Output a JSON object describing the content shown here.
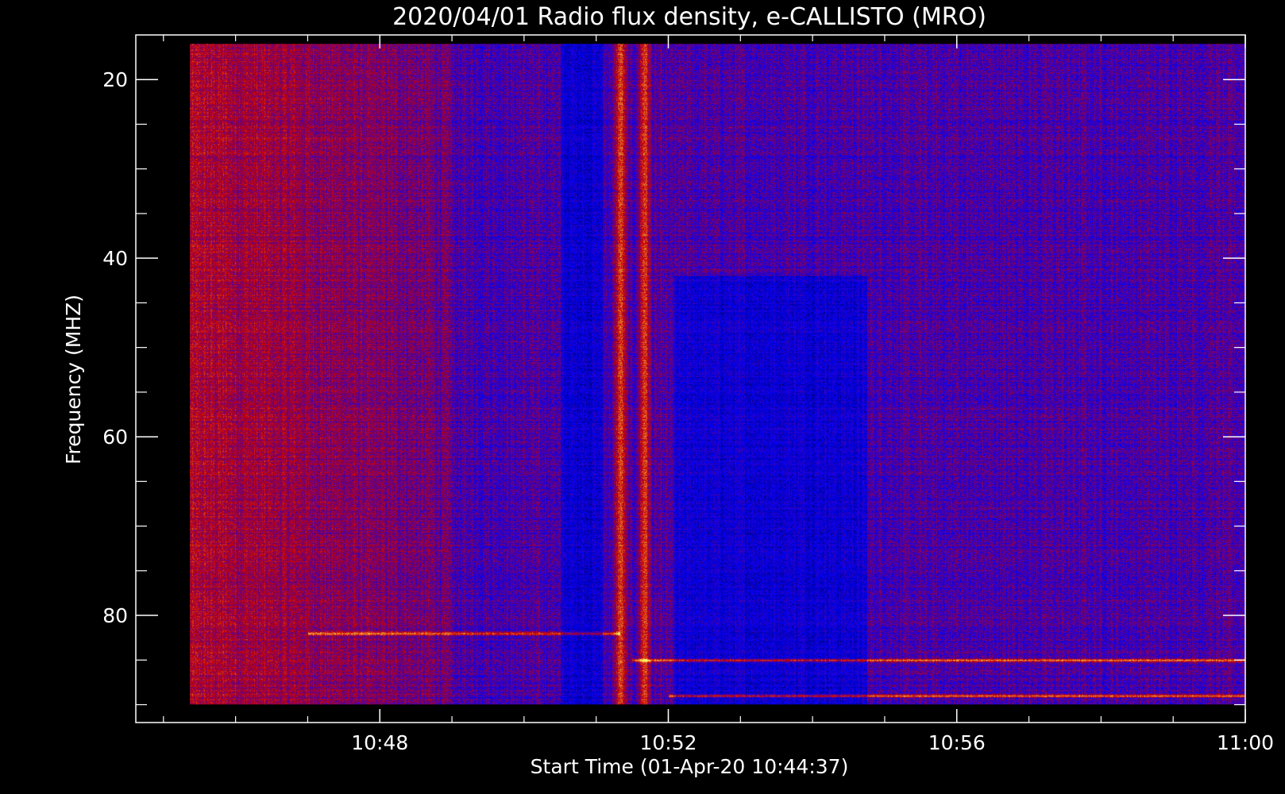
{
  "chart_data": {
    "type": "heatmap",
    "title": "2020/04/01  Radio flux density, e-CALLISTO (MRO)",
    "xlabel": "Start Time (01-Apr-20 10:44:37)",
    "ylabel": "Frequency (MHZ)",
    "xlim": [
      "10:44:37",
      "11:00:00"
    ],
    "ylim": [
      15,
      92
    ],
    "y_inverted": true,
    "x_ticks": [
      "10:48",
      "10:52",
      "10:56",
      "11:00"
    ],
    "y_ticks": [
      20,
      40,
      60,
      80
    ],
    "data_extent": {
      "x": [
        "10:45:22",
        "11:00:00"
      ],
      "y": [
        16,
        90
      ]
    },
    "colormap": [
      "#000000",
      "#0000ff",
      "#cc0000",
      "#ffff66"
    ],
    "features": [
      {
        "kind": "burst",
        "time": "10:51:20",
        "freq_range": [
          16,
          90
        ]
      },
      {
        "kind": "burst",
        "time": "10:51:40",
        "freq_range": [
          16,
          90
        ]
      },
      {
        "kind": "emission_line",
        "freq": 82,
        "time_range": [
          "10:47:00",
          "10:51:20"
        ]
      },
      {
        "kind": "emission_line",
        "freq": 85,
        "time_range": [
          "10:51:30",
          "11:00:00"
        ]
      },
      {
        "kind": "emission_line",
        "freq": 89,
        "time_range": [
          "10:52:00",
          "11:00:00"
        ]
      }
    ]
  }
}
